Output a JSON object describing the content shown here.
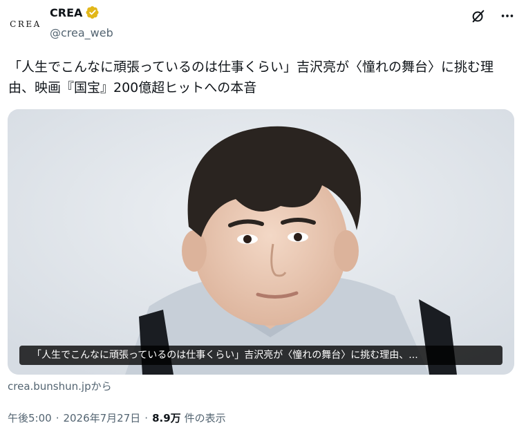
{
  "account": {
    "logo_text": "CREA",
    "display_name": "CREA",
    "handle": "@crea_web",
    "verified_color": "#E2B719"
  },
  "header_icons": [
    "grok-icon",
    "more-icon"
  ],
  "tweet": {
    "text": "「人生でこんなに頑張っているのは仕事くらい」吉沢亮が〈憧れの舞台〉に挑む理由、映画『国宝』200億超ヒットへの本音"
  },
  "media": {
    "caption": "「人生でこんなに頑張っているのは仕事くらい」吉沢亮が〈憧れの舞台〉に挑む理由、..."
  },
  "link_source": "crea.bunshun.jpから",
  "meta": {
    "time": "午後5:00",
    "date": "2026年7月27日",
    "views_count": "8.9万",
    "views_label": "件の表示",
    "separator": "·"
  }
}
